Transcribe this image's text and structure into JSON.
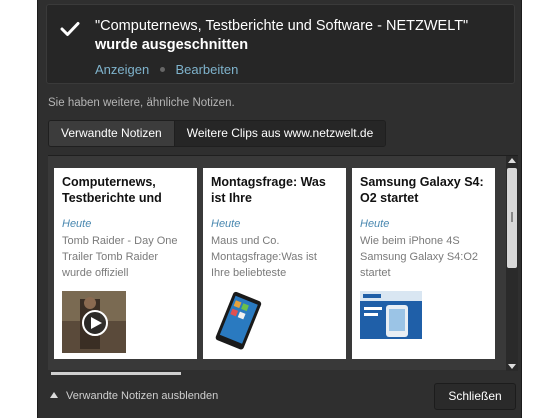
{
  "header": {
    "title_line1": "\"Computernews, Testberichte und Software - NETZWELT\"",
    "title_line2": "wurde ausgeschnitten",
    "action_view": "Anzeigen",
    "action_edit": "Bearbeiten"
  },
  "subtitle": "Sie haben weitere, ähnliche Notizen.",
  "tabs": [
    {
      "label": "Verwandte Notizen",
      "active": true
    },
    {
      "label": "Weitere Clips aus www.netzwelt.de",
      "active": false
    }
  ],
  "cards": [
    {
      "title": "Computernews, Testberichte und",
      "date": "Heute",
      "snippet": "Tomb Raider - Day One Trailer Tomb Raider wurde offiziell",
      "thumbnail": "video-thumbnail"
    },
    {
      "title": "Montagsfrage: Was ist Ihre",
      "date": "Heute",
      "snippet": "Maus und Co. Montagsfrage:Was ist Ihre beliebteste",
      "thumbnail": "tablet-thumbnail"
    },
    {
      "title": "Samsung Galaxy S4: O2 startet",
      "date": "Heute",
      "snippet": "Wie beim iPhone 4S Samsung Galaxy S4:O2 startet",
      "thumbnail": "phone-thumbnail"
    }
  ],
  "footer": {
    "toggle_label": "Verwandte Notizen ausblenden",
    "close_label": "Schließen"
  },
  "colors": {
    "panel_bg": "#2f2f2f",
    "link": "#7fb3cc",
    "date": "#4a88b0"
  }
}
